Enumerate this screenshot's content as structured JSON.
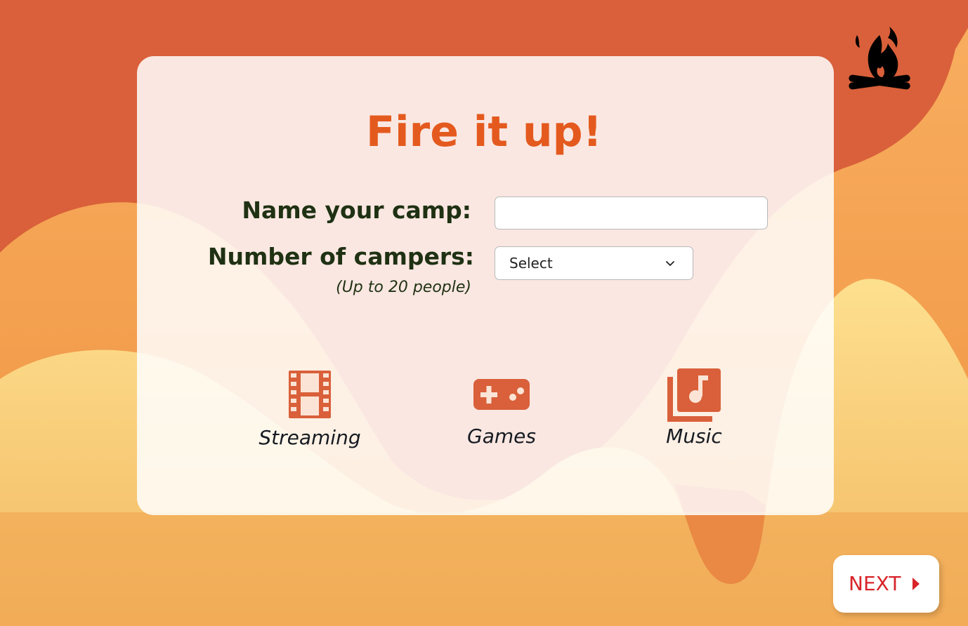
{
  "form": {
    "title": "Fire it up!",
    "camp_name_label": "Name your camp:",
    "camp_name_value": "",
    "campers_label": "Number of campers:",
    "campers_hint": "(Up to 20 people)",
    "campers_select_value": "Select"
  },
  "options": [
    {
      "label": "Streaming",
      "icon": "film-icon"
    },
    {
      "label": "Games",
      "icon": "gamepad-icon"
    },
    {
      "label": "Music",
      "icon": "music-library-icon"
    }
  ],
  "footer": {
    "next_label": "NEXT",
    "next_icon": "caret-right-icon"
  },
  "logo": {
    "icon": "campfire-icon"
  },
  "colors": {
    "background_top": "#d9603a",
    "background_light": "#f7a75a",
    "background_yellow": "#fde08f",
    "title": "#e45a1e",
    "label": "#1f3113",
    "icon": "#d9603a",
    "next_text": "#d8242a"
  }
}
